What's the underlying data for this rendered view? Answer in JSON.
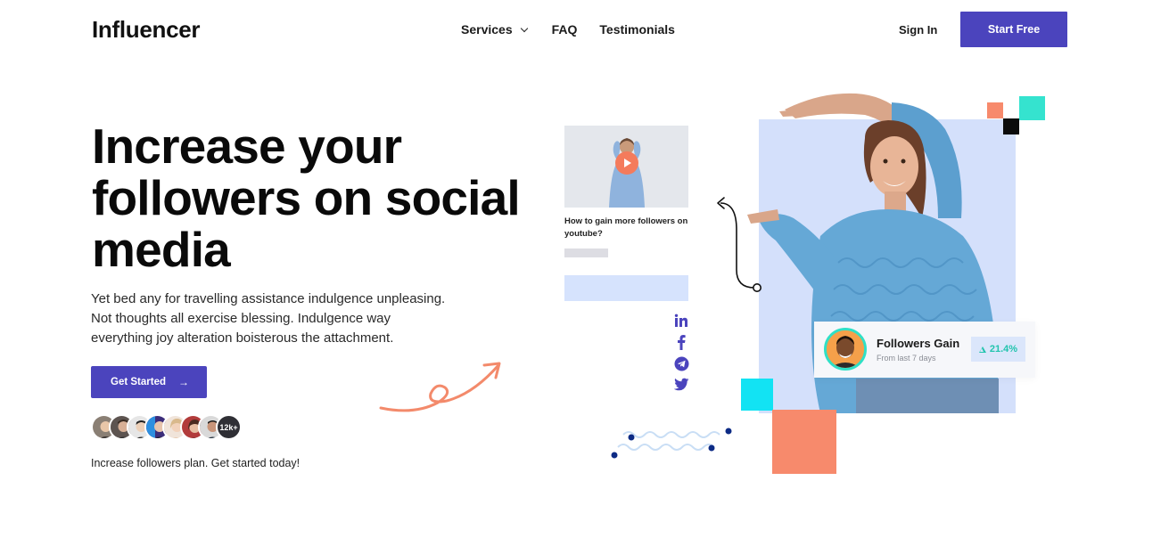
{
  "nav": {
    "logo": "Influencer",
    "menu": [
      {
        "label": "Services",
        "has_dropdown": true
      },
      {
        "label": "FAQ"
      },
      {
        "label": "Testimonials"
      }
    ],
    "sign_in": "Sign In",
    "cta": "Start Free"
  },
  "hero": {
    "title_lines": [
      "Increase your",
      "followers on social",
      "media"
    ],
    "description_lines": [
      "Yet bed any for travelling assistance indulgence unpleasing.",
      "Not thoughts all exercise blessing. Indulgence way",
      "everything joy alteration boisterous the attachment."
    ],
    "button_label": "Get Started",
    "button_arrow": "→",
    "avatar_count_label": "12k+",
    "note": "Increase followers plan. Get started today!"
  },
  "video_card": {
    "caption": "How to gain more followers on youtube?",
    "play_icon": "play-icon"
  },
  "social_icons": [
    "linkedin-icon",
    "facebook-icon",
    "telegram-icon",
    "twitter-icon"
  ],
  "stat_card": {
    "title": "Followers Gain",
    "subtitle": "From last 7 days",
    "value": "21.4%",
    "trend": "up"
  },
  "colors": {
    "primary": "#4b44bd",
    "salmon": "#f78a6c",
    "teal": "#35e3cf",
    "cyan": "#12e3f3",
    "photo_bg": "#d4e0fb",
    "badge_text": "#22c4ae"
  }
}
